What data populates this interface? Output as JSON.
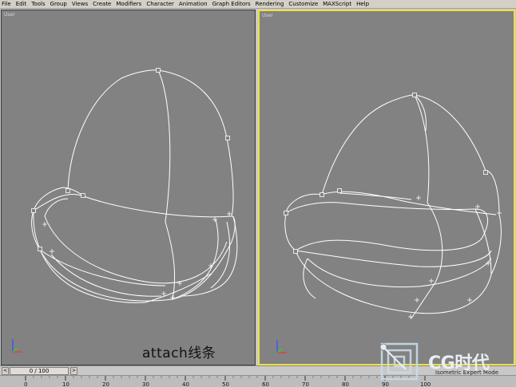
{
  "menubar": {
    "items": [
      "File",
      "Edit",
      "Tools",
      "Group",
      "Views",
      "Create",
      "Modifiers",
      "Character",
      "Animation",
      "Graph Editors",
      "Rendering",
      "Customize",
      "MAXScript",
      "Help"
    ]
  },
  "viewports": {
    "left_label": "User",
    "right_label": "User",
    "active": "right"
  },
  "caption": "attach线条",
  "watermark": {
    "text": "CG时代"
  },
  "timeslider": {
    "frame_display": "0 / 100",
    "prev_glyph": "<",
    "next_glyph": ">"
  },
  "trackbar": {
    "ticks": [
      "0",
      "10",
      "20",
      "30",
      "40",
      "50",
      "60",
      "70",
      "80",
      "90",
      "100"
    ]
  },
  "status_text": "Isometric Expert Mode",
  "colors": {
    "viewport_bg": "#828282",
    "wire": "#ffffff",
    "active_border": "#f0e040"
  }
}
